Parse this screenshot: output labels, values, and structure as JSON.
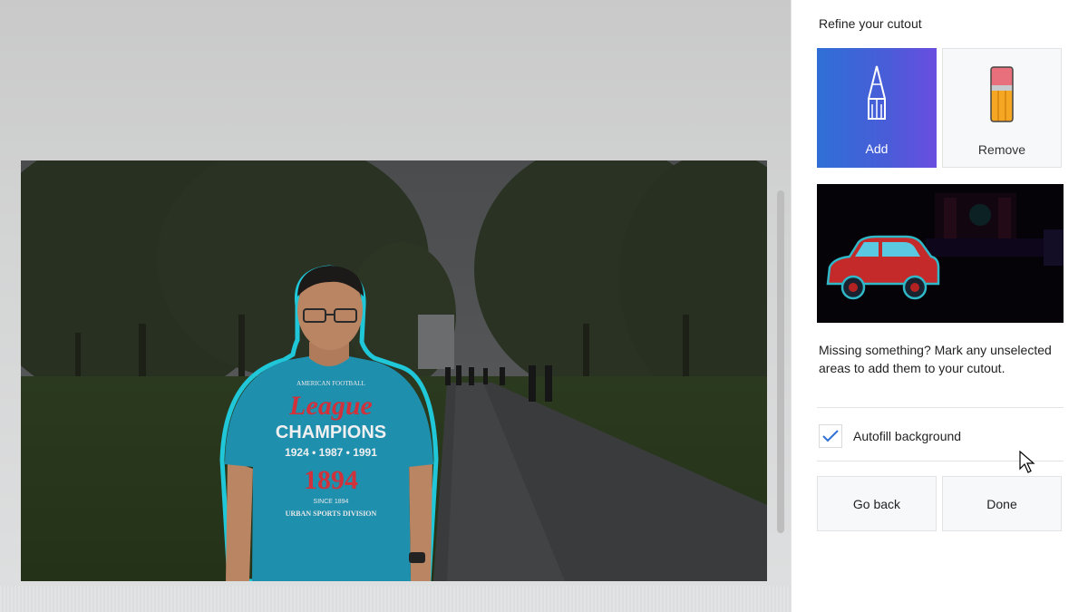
{
  "panel": {
    "title": "Refine your cutout",
    "tools": [
      {
        "label": "Add",
        "icon": "pen-icon",
        "selected": true
      },
      {
        "label": "Remove",
        "icon": "eraser-icon",
        "selected": false
      }
    ],
    "help_text": "Missing something? Mark any unselected areas to add them to your cutout.",
    "autofill": {
      "label": "Autofill background",
      "checked": true
    },
    "buttons": {
      "back": "Go back",
      "done": "Done"
    }
  },
  "photo": {
    "shirt": {
      "line1": "AMERICAN FOOTBALL",
      "line2": "League",
      "line3": "CHAMPIONS",
      "line4": "1924 • 1987 • 1991",
      "line5": "1894",
      "line6": "SINCE 1894",
      "line7": "URBAN SPORTS DIVISION"
    }
  },
  "colors": {
    "accent_start": "#2f6fd6",
    "accent_end": "#6a4de0",
    "cutout_outline": "#1fc7d8",
    "shirt": "#1f8fae"
  }
}
